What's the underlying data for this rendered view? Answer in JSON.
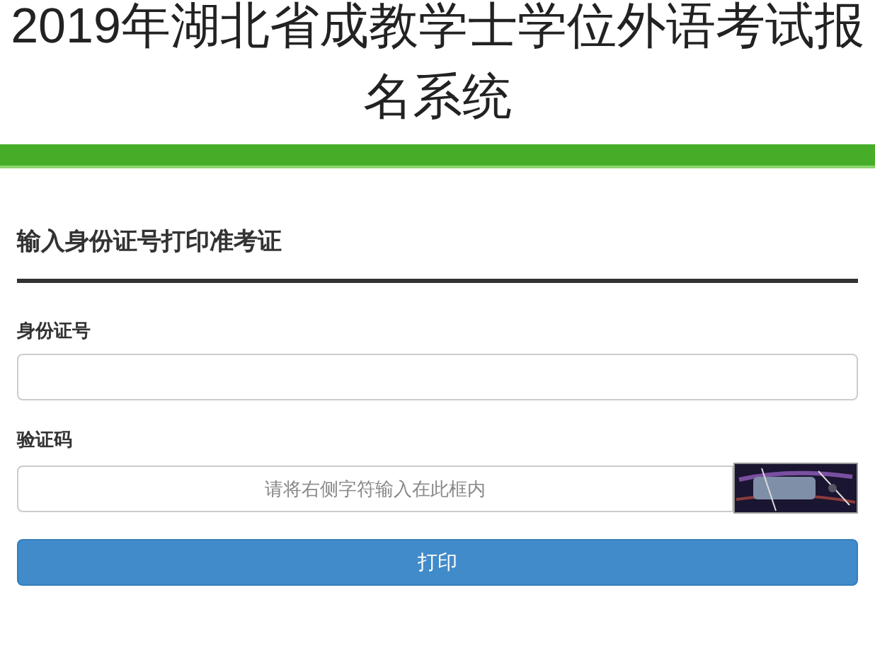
{
  "header": {
    "title": "2019年湖北省成教学士学位外语考试报名系统"
  },
  "form": {
    "heading": "输入身份证号打印准考证",
    "id_field": {
      "label": "身份证号"
    },
    "captcha_field": {
      "label": "验证码",
      "placeholder": "请将右侧字符输入在此框内"
    },
    "submit": "打印"
  }
}
